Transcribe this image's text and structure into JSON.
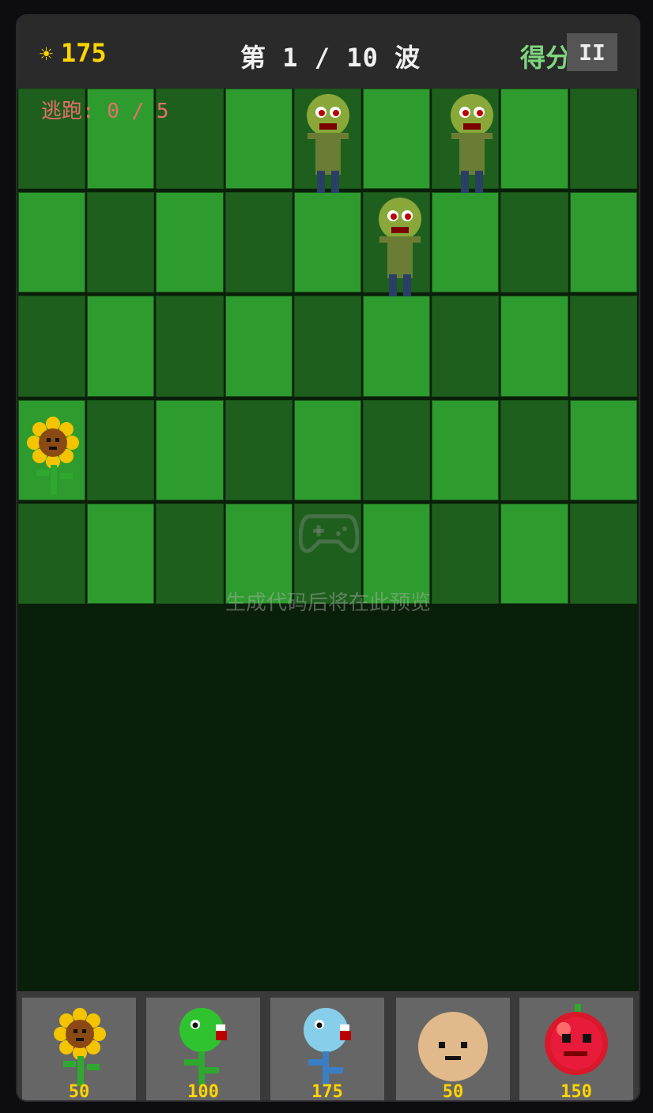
{
  "hud": {
    "sun_icon": "sun-icon",
    "sun_value": "175",
    "wave_text": "第 1 / 10 波",
    "score_label": "得分",
    "pause_label": "II",
    "escape_text": "逃跑: 0 / 5"
  },
  "preview": {
    "placeholder_text": "生成代码后将在此预览",
    "icon": "gamepad-icon"
  },
  "board": {
    "rows": 5,
    "cols": 9,
    "plants": [
      {
        "type": "sunflower",
        "row": 4,
        "col": 1
      }
    ],
    "zombies": [
      {
        "type": "zombie",
        "row": 1,
        "col": 5
      },
      {
        "type": "zombie",
        "row": 1,
        "col": 7
      },
      {
        "type": "zombie",
        "row": 2,
        "col": 6
      }
    ]
  },
  "shop": [
    {
      "name": "sunflower",
      "cost": "50"
    },
    {
      "name": "peashooter",
      "cost": "100"
    },
    {
      "name": "snow-pea",
      "cost": "175"
    },
    {
      "name": "wall-nut",
      "cost": "50"
    },
    {
      "name": "cherry-bomb",
      "cost": "150"
    }
  ],
  "colors": {
    "lawn_light": "#2e9b2e",
    "lawn_dark": "#1e5f1e",
    "sun": "#ffd400",
    "score": "#7ed67e",
    "escape": "#e8706a"
  }
}
